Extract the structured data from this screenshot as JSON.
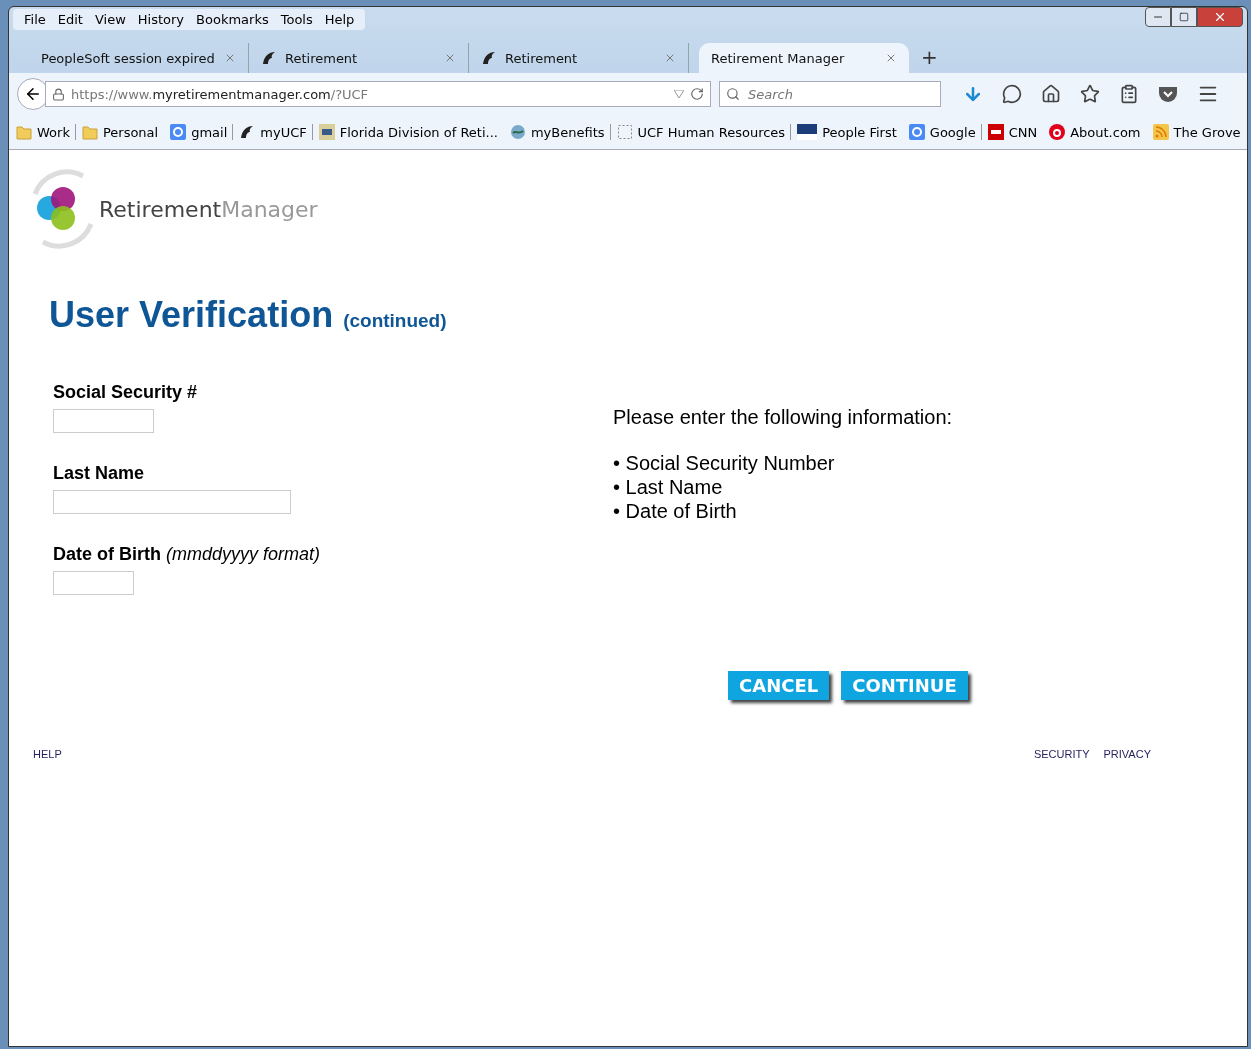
{
  "menu": [
    "File",
    "Edit",
    "View",
    "History",
    "Bookmarks",
    "Tools",
    "Help"
  ],
  "tabs": [
    {
      "title": "PeopleSoft session expired",
      "kind": "plain",
      "selected": false
    },
    {
      "title": "Retirement",
      "kind": "pegasus",
      "selected": false
    },
    {
      "title": "Retirement",
      "kind": "pegasus",
      "selected": false
    },
    {
      "title": "Retirement Manager",
      "kind": "plain",
      "selected": true
    }
  ],
  "new_tab": "+",
  "url": {
    "prefix": "https://www.",
    "domain": "myretirementmanager.com",
    "suffix": "/?UCF"
  },
  "search": {
    "placeholder": "Search"
  },
  "bookmarks": [
    {
      "label": "Work",
      "kind": "folder",
      "divider_after": true
    },
    {
      "label": "Personal",
      "kind": "folder",
      "divider_after": false
    },
    {
      "label": "gmail",
      "kind": "google",
      "divider_after": true
    },
    {
      "label": "myUCF",
      "kind": "pegasus",
      "divider_after": true
    },
    {
      "label": "Florida Division of Reti...",
      "kind": "frs",
      "divider_after": false
    },
    {
      "label": "myBenefits",
      "kind": "globe",
      "divider_after": true
    },
    {
      "label": "UCF Human Resources",
      "kind": "dashed",
      "divider_after": true
    },
    {
      "label": "People First",
      "kind": "flag",
      "divider_after": false
    },
    {
      "label": "Google",
      "kind": "google",
      "divider_after": true
    },
    {
      "label": "CNN",
      "kind": "cnn",
      "divider_after": false
    },
    {
      "label": "About.com",
      "kind": "about",
      "divider_after": false
    },
    {
      "label": "The Grove",
      "kind": "rss",
      "divider_after": false
    }
  ],
  "logo": {
    "word1": "Retirement",
    "word2": "Manager"
  },
  "heading": {
    "title": "User Verification",
    "note": "(continued)"
  },
  "fields": [
    {
      "label": "Social Security #"
    },
    {
      "label": "Last Name"
    },
    {
      "label": "Date of Birth",
      "hint": "(mmddyyyy format)"
    }
  ],
  "instructions": {
    "intro": "Please enter the following information:",
    "items": [
      "• Social Security Number",
      "• Last Name",
      "• Date of Birth"
    ]
  },
  "buttons": [
    "CANCEL",
    "CONTINUE"
  ],
  "footer": {
    "left": [
      "HELP"
    ],
    "right": [
      "SECURITY",
      "PRIVACY"
    ]
  }
}
